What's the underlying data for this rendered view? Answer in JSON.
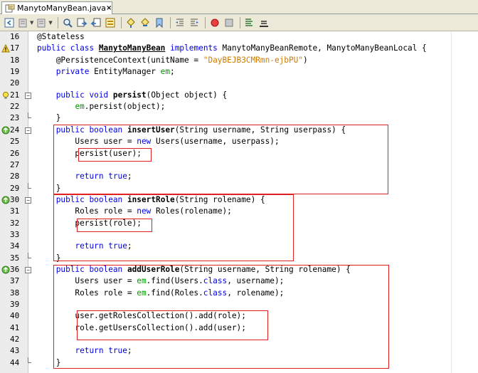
{
  "tab": {
    "title": "ManytoManyBean.java",
    "close": "×"
  },
  "toolbar": {
    "icons": [
      "back-icon",
      "forward-history-icon",
      "next-history-icon",
      "find-icon",
      "find-prev-icon",
      "find-next-icon",
      "toggle-highlight-icon",
      "prev-bookmark-icon",
      "next-bookmark-icon",
      "toggle-bookmark-icon",
      "shift-left-icon",
      "shift-right-icon",
      "start-macro-icon",
      "stop-macro-icon",
      "comment-icon",
      "uncomment-icon"
    ]
  },
  "colors": {
    "keyword": "#0000e6",
    "string": "#ce7b00",
    "field": "#009900",
    "highlight": "#e02020"
  },
  "lines": [
    {
      "num": "16",
      "text": "@Stateless"
    },
    {
      "num": "17",
      "icon": "warning-icon",
      "text": "public class ManytoManyBean implements ManytoManyBeanRemote, ManytoManyBeanLocal {"
    },
    {
      "num": "18",
      "text": "    @PersistenceContext(unitName = \"DayBEJB3CMRmn-ejbPU\")"
    },
    {
      "num": "19",
      "text": "    private EntityManager em;"
    },
    {
      "num": "20",
      "text": ""
    },
    {
      "num": "21",
      "icon": "hint-bulb-icon",
      "text": "    public void persist(Object object) {"
    },
    {
      "num": "22",
      "text": "        em.persist(object);"
    },
    {
      "num": "23",
      "text": "    }"
    },
    {
      "num": "24",
      "icon": "implements-icon",
      "text": "    public boolean insertUser(String username, String userpass) {"
    },
    {
      "num": "25",
      "text": "        Users user = new Users(username, userpass);"
    },
    {
      "num": "26",
      "text": "        persist(user);"
    },
    {
      "num": "27",
      "text": ""
    },
    {
      "num": "28",
      "text": "        return true;"
    },
    {
      "num": "29",
      "text": "    }"
    },
    {
      "num": "30",
      "icon": "implements-icon",
      "text": "    public boolean insertRole(String rolename) {"
    },
    {
      "num": "31",
      "text": "        Roles role = new Roles(rolename);"
    },
    {
      "num": "32",
      "text": "        persist(role);"
    },
    {
      "num": "33",
      "text": ""
    },
    {
      "num": "34",
      "text": "        return true;"
    },
    {
      "num": "35",
      "text": "    }"
    },
    {
      "num": "36",
      "icon": "implements-icon",
      "text": "    public boolean addUserRole(String username, String rolename) {"
    },
    {
      "num": "37",
      "text": "        Users user = em.find(Users.class, username);"
    },
    {
      "num": "38",
      "text": "        Roles role = em.find(Roles.class, rolename);"
    },
    {
      "num": "39",
      "text": ""
    },
    {
      "num": "40",
      "text": "        user.getRolesCollection().add(role);"
    },
    {
      "num": "41",
      "text": "        role.getUsersCollection().add(user);"
    },
    {
      "num": "42",
      "text": ""
    },
    {
      "num": "43",
      "text": "        return true;"
    },
    {
      "num": "44",
      "text": "    }"
    }
  ]
}
